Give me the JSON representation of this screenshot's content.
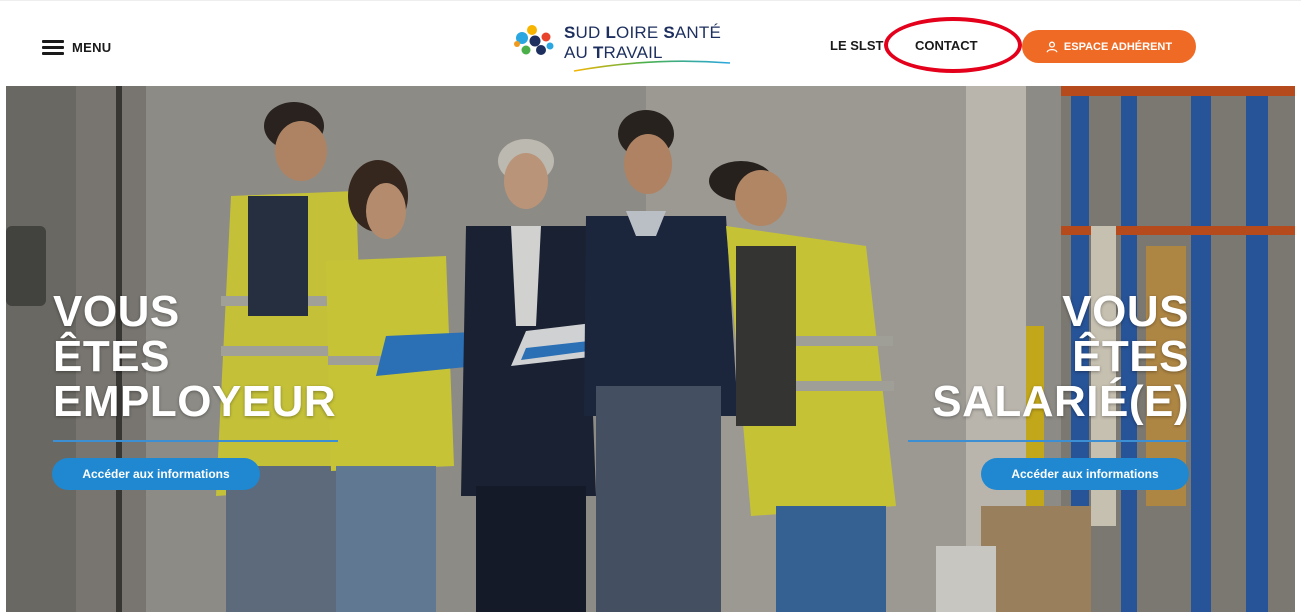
{
  "header": {
    "menu_label": "MENU",
    "logo": {
      "line1_parts": [
        "S",
        "UD ",
        "L",
        "OIRE ",
        "S",
        "ANTÉ"
      ],
      "line2_parts": [
        "AU ",
        "T",
        "RAVAIL"
      ]
    },
    "nav": {
      "slst": "LE SLST",
      "contact": "CONTACT"
    },
    "espace_button": "ESPACE ADHÉRENT"
  },
  "hero": {
    "left": {
      "title_lines": [
        "VOUS",
        "ÊTES",
        "EMPLOYEUR"
      ],
      "button": "Accéder aux informations"
    },
    "right": {
      "title_lines": [
        "VOUS",
        "ÊTES",
        "SALARIÉ(E)"
      ],
      "button": "Accéder aux informations"
    }
  },
  "colors": {
    "accent_orange": "#ef6b25",
    "button_blue": "#1f88d0",
    "divider_blue": "#3d8fd3",
    "annotation_red": "#e4001b",
    "logo_navy": "#1d2f5e"
  },
  "icons": [
    "hamburger-icon",
    "user-icon"
  ]
}
